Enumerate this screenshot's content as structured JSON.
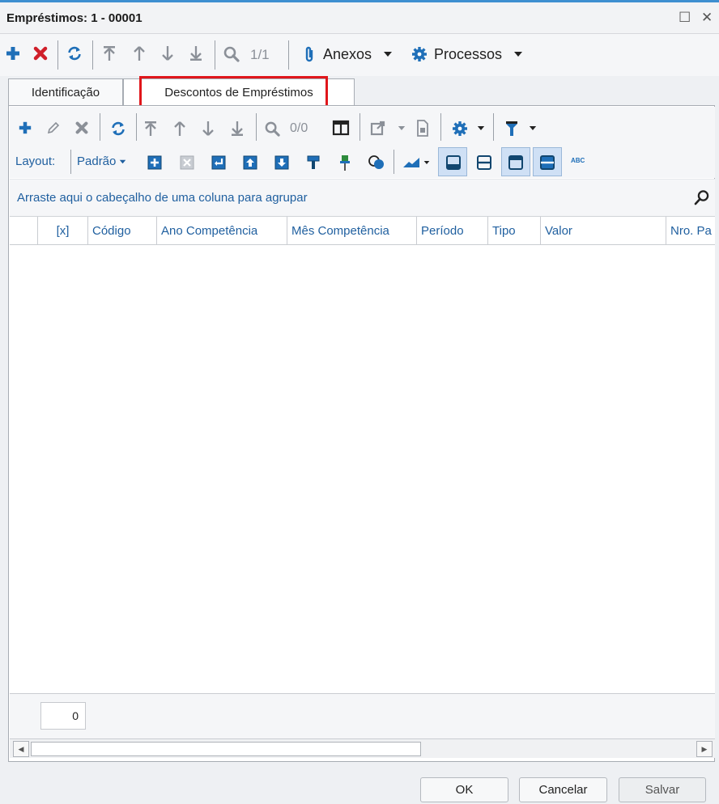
{
  "window": {
    "title": "Empréstimos: 1 - 00001",
    "restore_glyph": "☐",
    "close_glyph": "✕"
  },
  "main_toolbar": {
    "record_counter": "1/1",
    "anexos_label": "Anexos",
    "processos_label": "Processos"
  },
  "tabs": [
    {
      "label": "Identificação",
      "active": false
    },
    {
      "label": "Descontos de Empréstimos",
      "active": true
    }
  ],
  "grid_toolbar": {
    "record_counter": "0/0",
    "layout_label": "Layout:",
    "layout_value": "Padrão",
    "abc_label": "ABC"
  },
  "group_area": {
    "hint": "Arraste aqui o cabeçalho de uma coluna para agrupar"
  },
  "columns": [
    "[x]",
    "Código",
    "Ano Competência",
    "Mês Competência",
    "Período",
    "Tipo",
    "Valor",
    "Nro. Pa"
  ],
  "footer": {
    "count": "0"
  },
  "buttons": {
    "ok": "OK",
    "cancel": "Cancelar",
    "save": "Salvar"
  },
  "colors": {
    "accent": "#1f6fb8",
    "delete": "#d01f2a",
    "highlight": "#e0161b",
    "link_text": "#1f5f9f"
  }
}
